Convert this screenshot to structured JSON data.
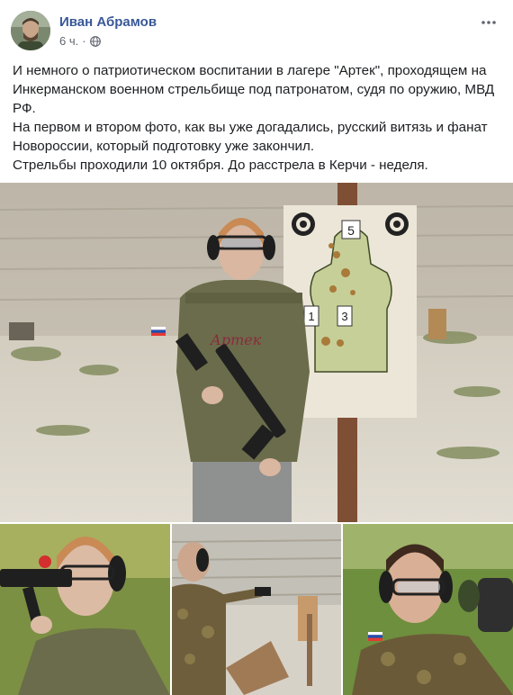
{
  "post": {
    "author": "Иван Абрамов",
    "time": "6 ч.",
    "separator": "·",
    "privacy_icon": "globe-icon",
    "more_icon": "more-dots-icon",
    "text_lines": [
      "И немного о патриотическом воспитании в лагере \"Артек\", проходящем на Инкерманском военном стрельбище под патронатом, судя по оружию, МВД РФ.",
      "На первом и втором фото, как вы уже догадались, русский витязь и фанат Новороссии, который подготовку уже закончил.",
      "Стрельбы проходили 10 октября. До расстрела в Керчи - неделя."
    ]
  },
  "photos": {
    "main": {
      "hoodie_text": "Артек",
      "target_numbers": [
        "5",
        "1",
        "3"
      ]
    },
    "thumb_count": 3
  },
  "colors": {
    "link": "#385898",
    "meta": "#606770",
    "text": "#1c1e21"
  }
}
